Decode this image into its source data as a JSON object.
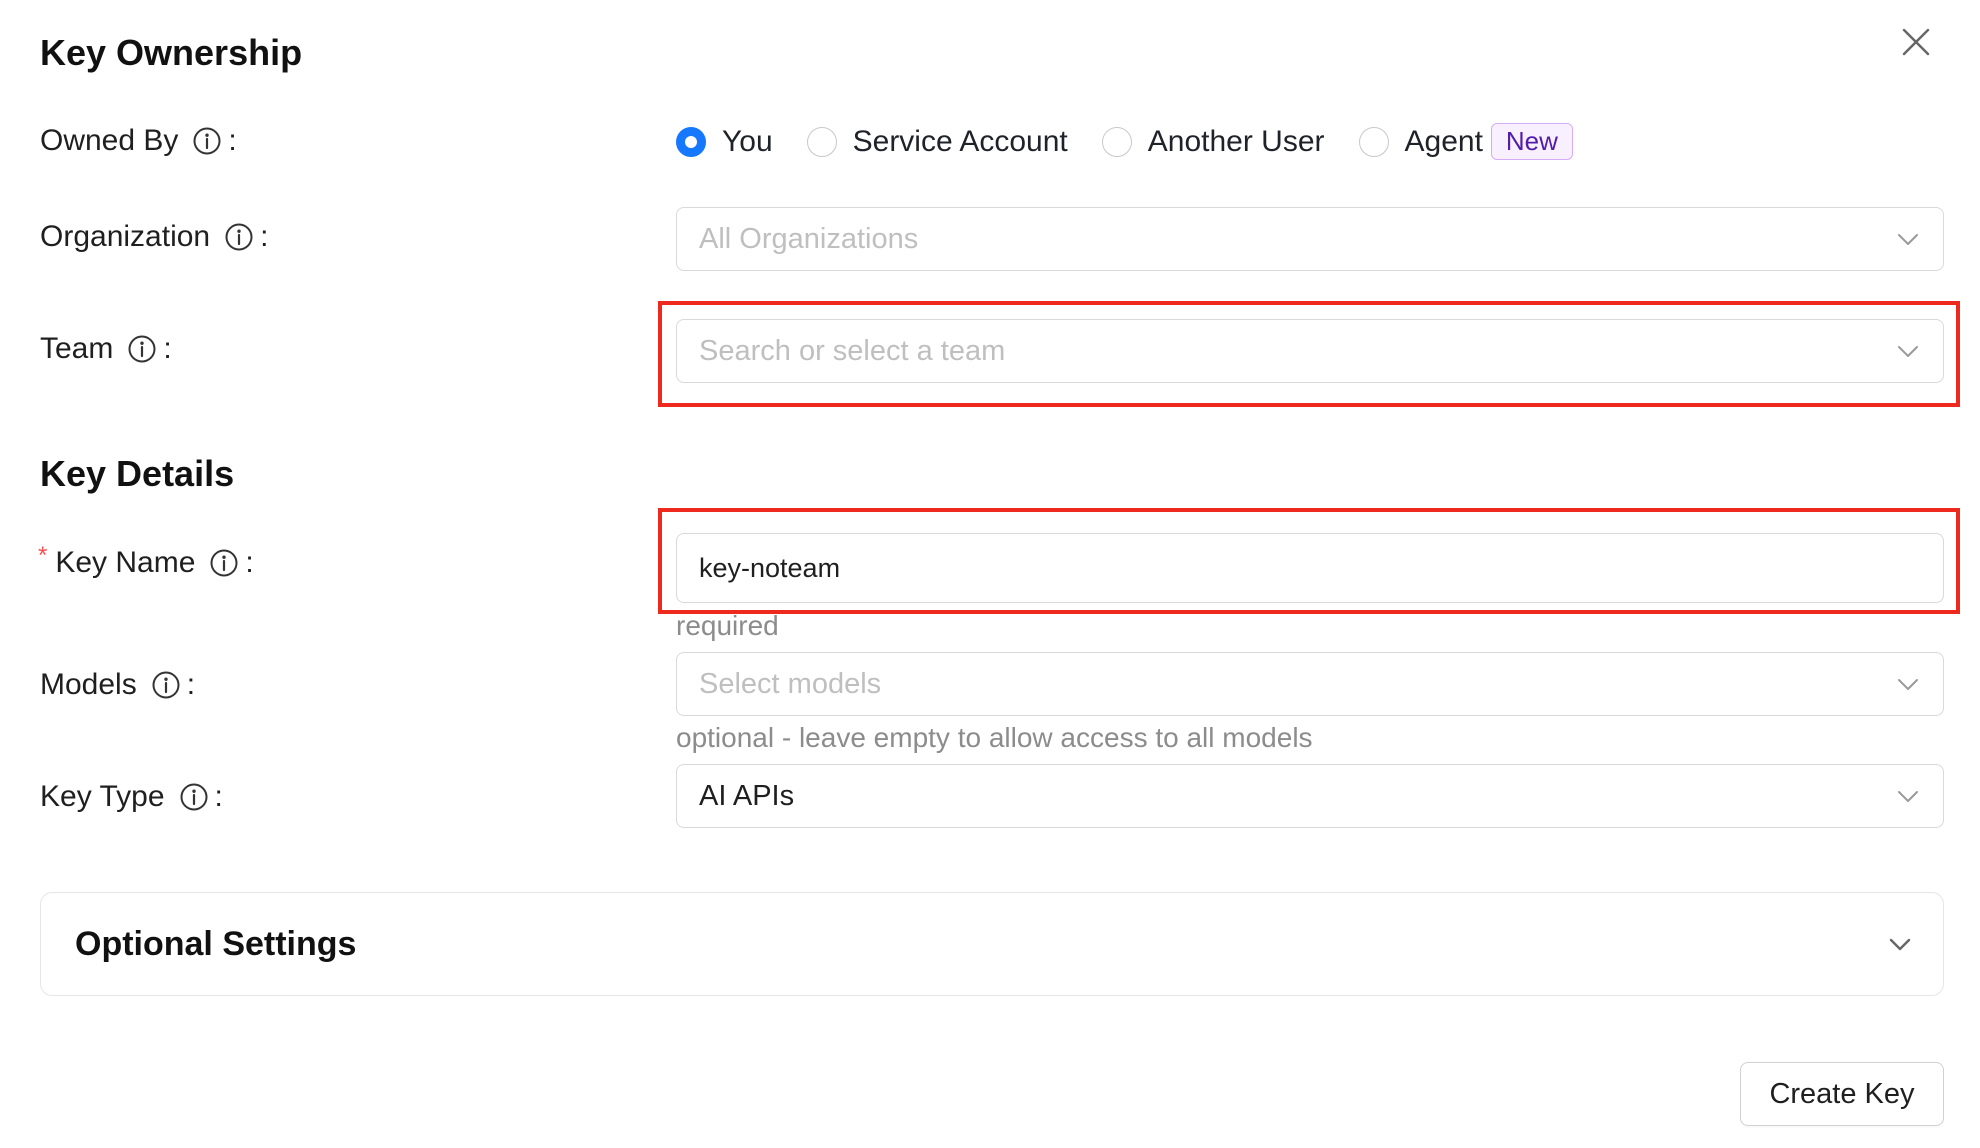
{
  "ownership": {
    "title": "Key Ownership",
    "owned_by_label": "Owned By",
    "colon": ":",
    "options": [
      {
        "label": "You",
        "checked": true
      },
      {
        "label": "Service Account",
        "checked": false
      },
      {
        "label": "Another User",
        "checked": false
      },
      {
        "label": "Agent",
        "checked": false
      }
    ],
    "new_badge": "New",
    "organization_label": "Organization",
    "organization_placeholder": "All Organizations",
    "team_label": "Team",
    "team_placeholder": "Search or select a team"
  },
  "details": {
    "title": "Key Details",
    "required_mark": "*",
    "key_name_label": "Key Name",
    "key_name_value": "key-noteam",
    "key_name_hint": "required",
    "models_label": "Models",
    "models_placeholder": "Select models",
    "models_hint": "optional - leave empty to allow access to all models",
    "key_type_label": "Key Type",
    "key_type_value": "AI APIs"
  },
  "optional_settings_title": "Optional Settings",
  "create_button": "Create Key",
  "colors": {
    "primary": "#1677ff",
    "highlight": "#ee2a1f",
    "badge_text": "#531dab",
    "badge_bg": "#f9f0ff"
  }
}
